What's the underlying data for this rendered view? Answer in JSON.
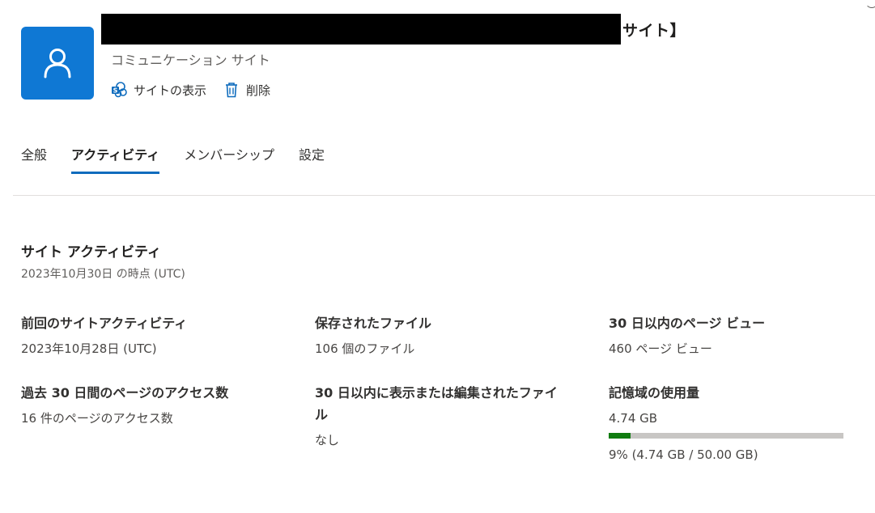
{
  "header": {
    "title_suffix": "サイト】",
    "subtitle": "コミュニケーション サイト",
    "actions": [
      {
        "label": "サイトの表示",
        "icon": "sharepoint-icon"
      },
      {
        "label": "削除",
        "icon": "trash-icon"
      }
    ],
    "avatar_icon": "person-icon",
    "accent_color": "#0f78d4"
  },
  "tabs": [
    {
      "label": "全般",
      "active": false
    },
    {
      "label": "アクティビティ",
      "active": true
    },
    {
      "label": "メンバーシップ",
      "active": false
    },
    {
      "label": "設定",
      "active": false
    }
  ],
  "activity": {
    "title": "サイト アクティビティ",
    "as_of": "2023年10月30日 の時点 (UTC)",
    "stats": {
      "last_activity": {
        "label": "前回のサイトアクティビティ",
        "value": "2023年10月28日 (UTC)"
      },
      "saved_files": {
        "label": "保存されたファイル",
        "value": "106 個のファイル"
      },
      "page_views": {
        "label": "30 日以内のページ ビュー",
        "value": "460 ページ ビュー"
      },
      "page_visits": {
        "label": "過去 30 日間のページのアクセス数",
        "value": "16 件のページのアクセス数"
      },
      "files_viewed": {
        "label": "30 日以内に表示または編集されたファイル",
        "value": "なし"
      },
      "storage": {
        "label": "記憶域の使用量",
        "value": "4.74 GB",
        "used_fraction": 0.0948,
        "caption": "9% (4.74 GB / 50.00 GB)",
        "bar_color": "#107c10"
      }
    }
  }
}
